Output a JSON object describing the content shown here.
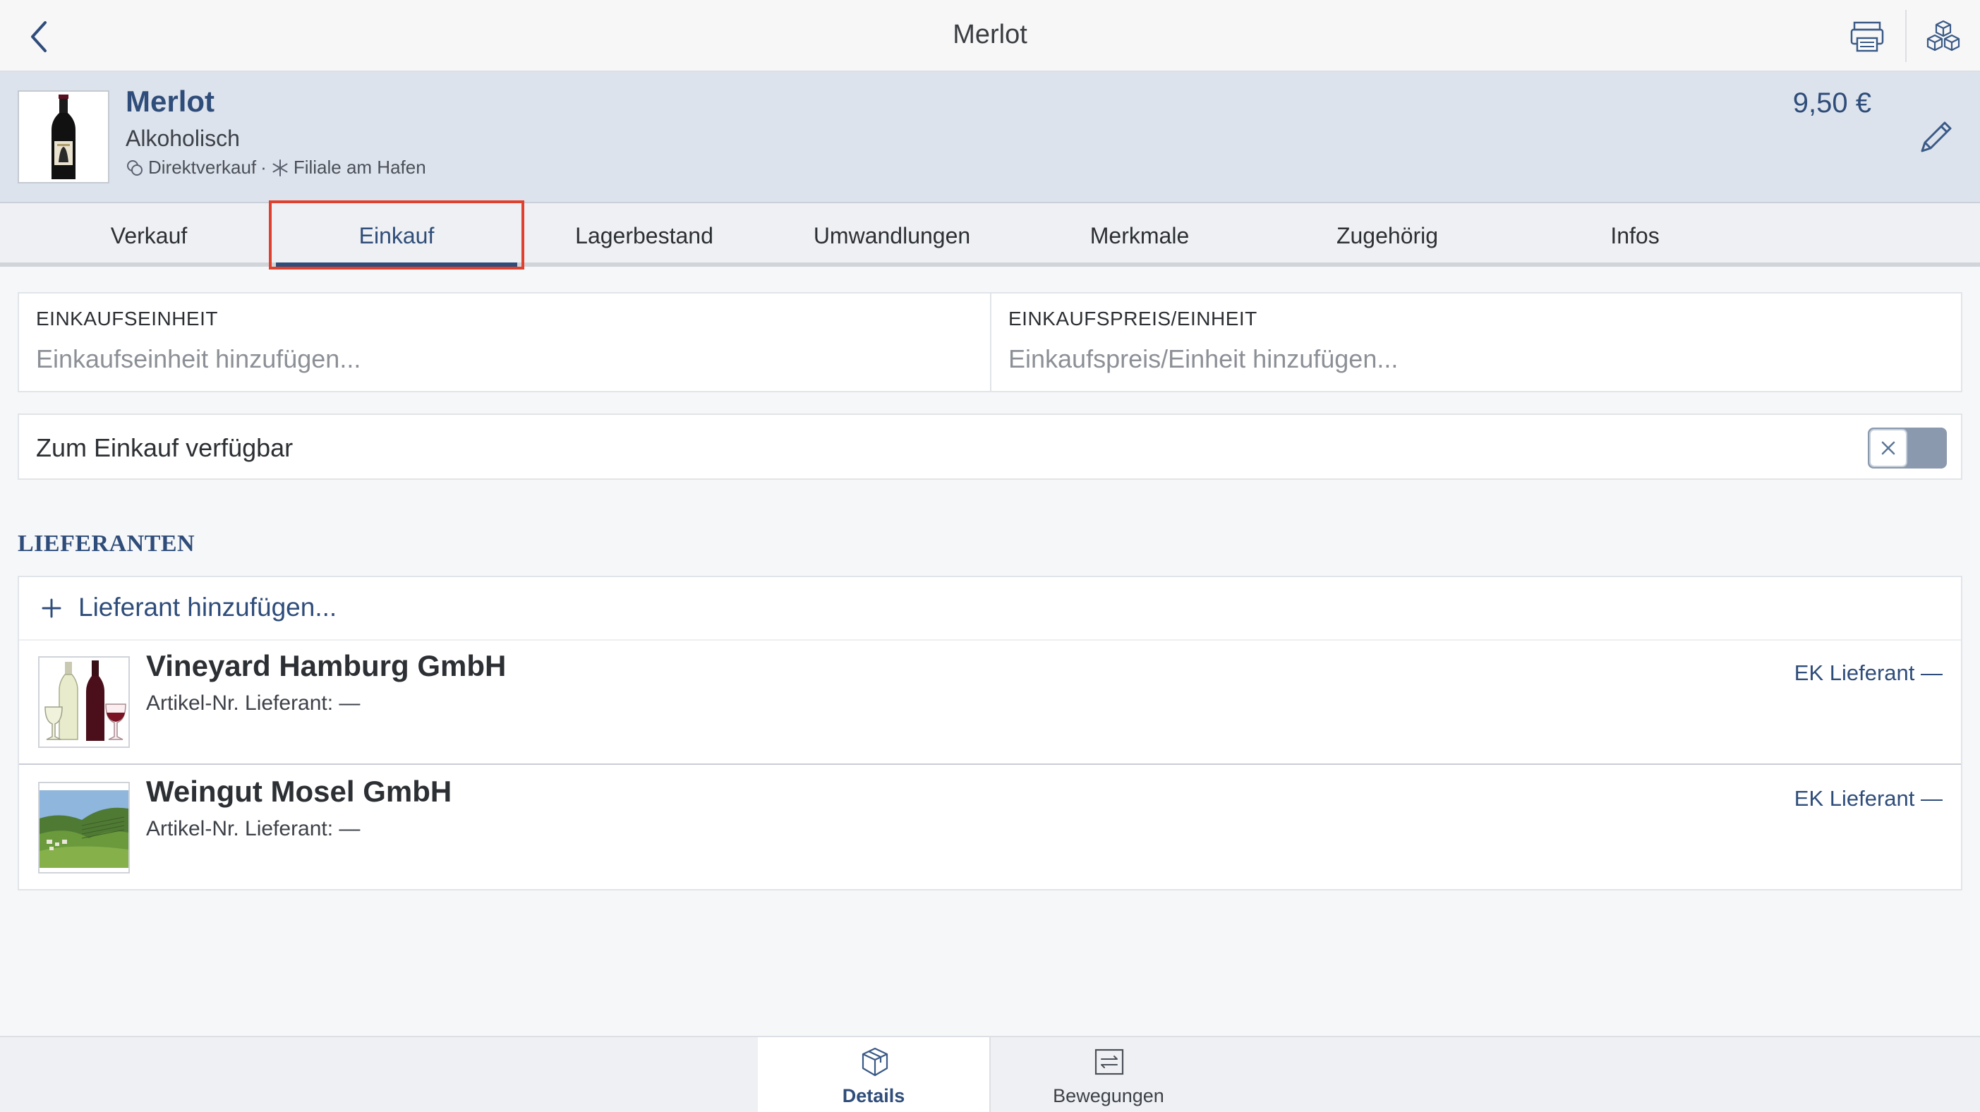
{
  "nav": {
    "title": "Merlot",
    "back_icon": "chevron-left-icon",
    "printer_icon": "printer-icon",
    "boxes_icon": "boxes-icon"
  },
  "product": {
    "name": "Merlot",
    "category": "Alkoholisch",
    "sales_channel": "Direktverkauf",
    "separator": "·",
    "branch": "Filiale am Hafen",
    "price": "9,50 €"
  },
  "tabs": [
    {
      "label": "Verkauf",
      "active": false
    },
    {
      "label": "Einkauf",
      "active": true
    },
    {
      "label": "Lagerbestand",
      "active": false
    },
    {
      "label": "Umwandlungen",
      "active": false
    },
    {
      "label": "Merkmale",
      "active": false
    },
    {
      "label": "Zugehörig",
      "active": false
    },
    {
      "label": "Infos",
      "active": false
    }
  ],
  "purchase": {
    "unit_label": "EINKAUFSEINHEIT",
    "unit_placeholder": "Einkaufseinheit hinzufügen...",
    "unit_value": "",
    "price_label": "EINKAUFSPREIS/EINHEIT",
    "price_placeholder": "Einkaufspreis/Einheit hinzufügen...",
    "price_value": "",
    "available_label": "Zum Einkauf verfügbar",
    "available": false
  },
  "suppliers": {
    "section_title": "LIEFERANTEN",
    "add_label": "Lieferant hinzufügen...",
    "items": [
      {
        "name": "Vineyard Hamburg GmbH",
        "article": "Artikel-Nr. Lieferant: —",
        "ek": "EK Lieferant —",
        "image": "wine-glasses-image"
      },
      {
        "name": "Weingut Mosel GmbH",
        "article": "Artikel-Nr. Lieferant: —",
        "ek": "EK Lieferant —",
        "image": "vineyard-landscape-image"
      }
    ]
  },
  "bottom_nav": {
    "details_label": "Details",
    "movements_label": "Bewegungen",
    "active": "Details"
  },
  "colors": {
    "accent": "#2f4d7a",
    "header_bg": "#dde3ec",
    "highlight_border": "#e0402e",
    "toggle_off": "#8a99ae"
  }
}
